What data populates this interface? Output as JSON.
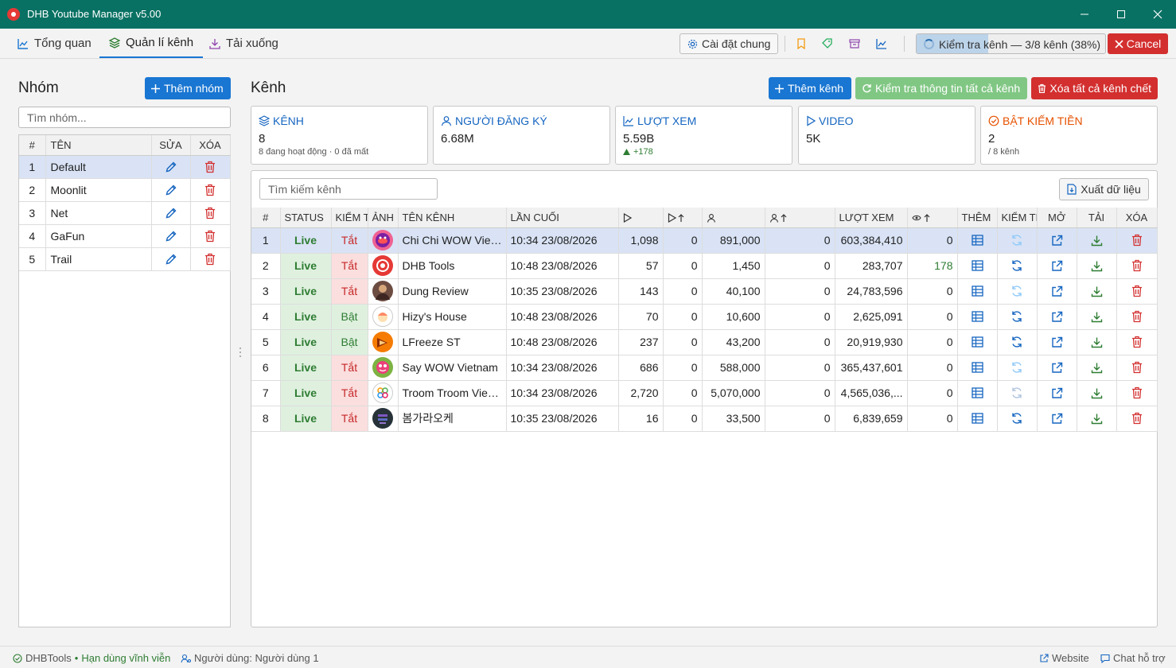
{
  "window": {
    "title": "DHB Youtube Manager v5.00"
  },
  "nav": {
    "tabs": [
      {
        "label": "Tổng quan"
      },
      {
        "label": "Quản lí kênh"
      },
      {
        "label": "Tải xuống"
      }
    ],
    "settings_label": "Cài đặt chung",
    "progress_text": "Kiểm tra kênh — 3/8 kênh (38%)",
    "progress_fraction": 0.38,
    "cancel_label": "Cancel"
  },
  "groups": {
    "title": "Nhóm",
    "add_label": "Thêm nhóm",
    "search_placeholder": "Tìm nhóm...",
    "columns": [
      "#",
      "TÊN",
      "SỬA",
      "XÓA"
    ],
    "rows": [
      {
        "idx": "1",
        "name": "Default"
      },
      {
        "idx": "2",
        "name": "Moonlit"
      },
      {
        "idx": "3",
        "name": "Net"
      },
      {
        "idx": "4",
        "name": "GaFun"
      },
      {
        "idx": "5",
        "name": "Trail"
      }
    ]
  },
  "channels": {
    "title": "Kênh",
    "add_label": "Thêm kênh",
    "check_all_label": "Kiểm tra thông tin tất cả kênh",
    "delete_dead_label": "Xóa tất cả kênh chết",
    "search_placeholder": "Tìm kiếm kênh",
    "export_label": "Xuất dữ liệu",
    "columns": [
      "#",
      "STATUS",
      "KIỂM TRA",
      "ẢNH",
      "TÊN KÊNH",
      "LẦN CUỐI",
      "",
      "",
      "",
      "",
      "LƯỢT XEM",
      "",
      "THÊM",
      "KIỂM TRA",
      "MỞ",
      "TẢI",
      "XÓA"
    ],
    "rows": [
      {
        "idx": "1",
        "status": "Live",
        "monetize": "Tắt",
        "name": "Chi Chi WOW Vietnam",
        "last": "10:34 23/08/2026",
        "videos": "1,098",
        "videos_delta": "0",
        "subs": "891,000",
        "subs_delta": "0",
        "views": "603,384,410",
        "views_delta": "0"
      },
      {
        "idx": "2",
        "status": "Live",
        "monetize": "Tắt",
        "name": "DHB Tools",
        "last": "10:48 23/08/2026",
        "videos": "57",
        "videos_delta": "0",
        "subs": "1,450",
        "subs_delta": "0",
        "views": "283,707",
        "views_delta": "178"
      },
      {
        "idx": "3",
        "status": "Live",
        "monetize": "Tắt",
        "name": "Dung Review",
        "last": "10:35 23/08/2026",
        "videos": "143",
        "videos_delta": "0",
        "subs": "40,100",
        "subs_delta": "0",
        "views": "24,783,596",
        "views_delta": "0"
      },
      {
        "idx": "4",
        "status": "Live",
        "monetize": "Bật",
        "name": "Hizy's House",
        "last": "10:48 23/08/2026",
        "videos": "70",
        "videos_delta": "0",
        "subs": "10,600",
        "subs_delta": "0",
        "views": "2,625,091",
        "views_delta": "0"
      },
      {
        "idx": "5",
        "status": "Live",
        "monetize": "Bật",
        "name": "LFreeze ST",
        "last": "10:48 23/08/2026",
        "videos": "237",
        "videos_delta": "0",
        "subs": "43,200",
        "subs_delta": "0",
        "views": "20,919,930",
        "views_delta": "0"
      },
      {
        "idx": "6",
        "status": "Live",
        "monetize": "Tắt",
        "name": "Say WOW Vietnam",
        "last": "10:34 23/08/2026",
        "videos": "686",
        "videos_delta": "0",
        "subs": "588,000",
        "subs_delta": "0",
        "views": "365,437,601",
        "views_delta": "0"
      },
      {
        "idx": "7",
        "status": "Live",
        "monetize": "Tắt",
        "name": "Troom Troom Vietnam",
        "last": "10:34 23/08/2026",
        "videos": "2,720",
        "videos_delta": "0",
        "subs": "5,070,000",
        "subs_delta": "0",
        "views": "4,565,036,...",
        "views_delta": "0"
      },
      {
        "idx": "8",
        "status": "Live",
        "monetize": "Tắt",
        "name": "봄가라오케",
        "last": "10:35 23/08/2026",
        "videos": "16",
        "videos_delta": "0",
        "subs": "33,500",
        "subs_delta": "0",
        "views": "6,839,659",
        "views_delta": "0"
      }
    ]
  },
  "stats": [
    {
      "label": "KÊNH",
      "value": "8",
      "sub": "8 đang hoạt động · 0 đã mất"
    },
    {
      "label": "NGƯỜI ĐĂNG KÝ",
      "value": "6.68M",
      "sub": ""
    },
    {
      "label": "LƯỢT XEM",
      "value": "5.59B",
      "sub": "+178"
    },
    {
      "label": "VIDEO",
      "value": "5K",
      "sub": ""
    },
    {
      "label": "BẬT KIẾM TIỀN",
      "value": "2",
      "sub": "/ 8 kênh"
    }
  ],
  "status_bar": {
    "brand": "DHBTools",
    "license": "Hạn dùng vĩnh viễn",
    "user": "Người dùng: Người dùng 1",
    "website": "Website",
    "chat": "Chat hỗ trợ"
  },
  "colors": {
    "titlebar": "#087163",
    "primary": "#1976d2",
    "danger": "#d32f2f",
    "success": "#2e7d32",
    "stat_accent": "#1565c0",
    "monetize_accent": "#e65100"
  }
}
